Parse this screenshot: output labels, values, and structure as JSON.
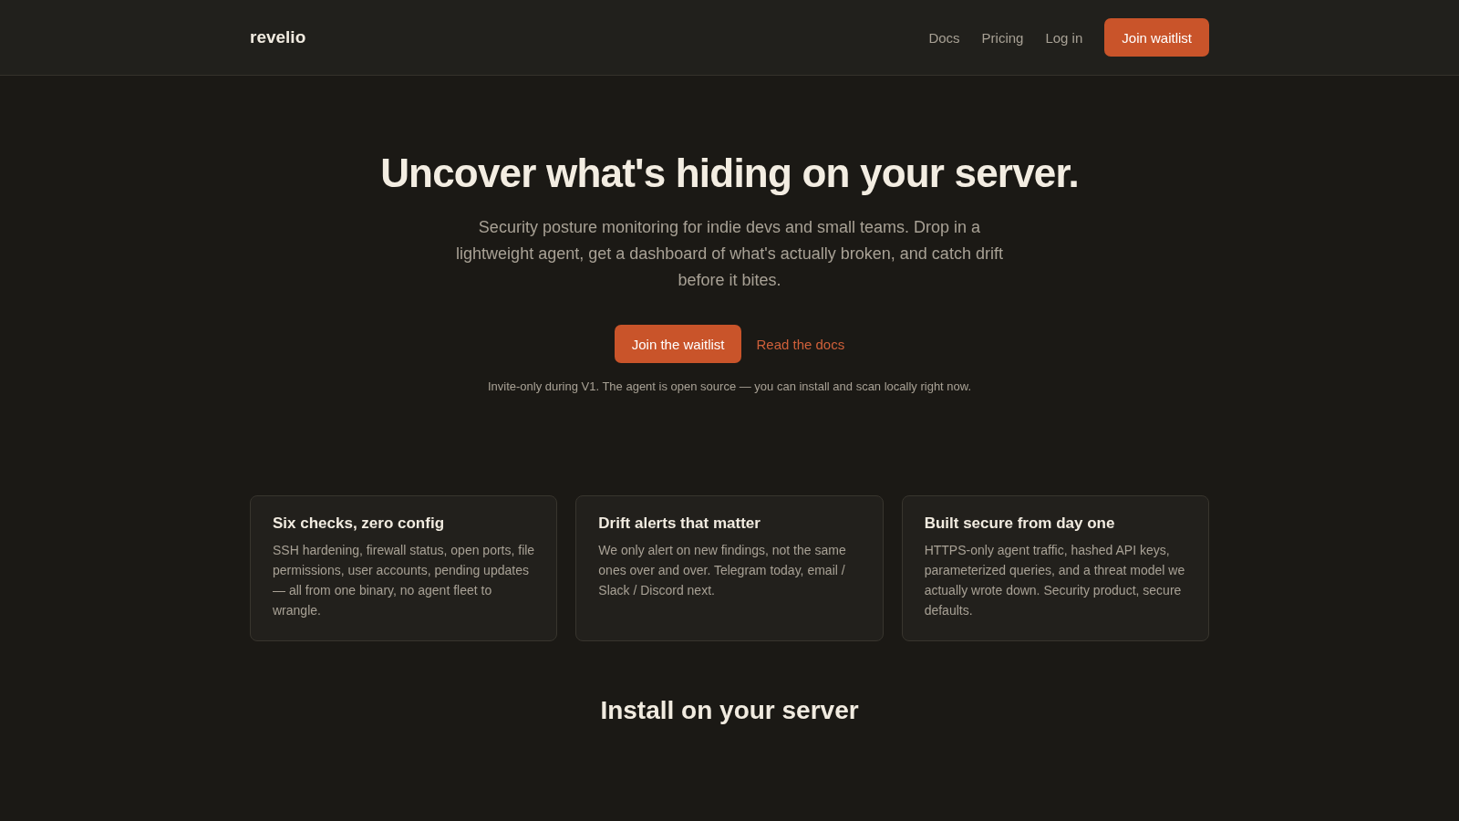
{
  "header": {
    "logo": "revelio",
    "nav": [
      "Docs",
      "Pricing",
      "Log in"
    ],
    "cta": "Join waitlist"
  },
  "hero": {
    "title": "Uncover what's hiding on your server.",
    "subtitle": "Security posture monitoring for indie devs and small teams. Drop in a lightweight agent, get a dashboard of what's actually broken, and catch drift before it bites.",
    "primary_button": "Join the waitlist",
    "secondary_link": "Read the docs",
    "note": "Invite-only during V1. The agent is open source — you can install and scan locally right now."
  },
  "features": [
    {
      "title": "Six checks, zero config",
      "body": "SSH hardening, firewall status, open ports, file permissions, user accounts, pending updates — all from one binary, no agent fleet to wrangle."
    },
    {
      "title": "Drift alerts that matter",
      "body": "We only alert on new findings, not the same ones over and over. Telegram today, email / Slack / Discord next."
    },
    {
      "title": "Built secure from day one",
      "body": "HTTPS-only agent traffic, hashed API keys, parameterized queries, and a threat model we actually wrote down. Security product, secure defaults."
    }
  ],
  "install": {
    "title": "Install on your server"
  }
}
